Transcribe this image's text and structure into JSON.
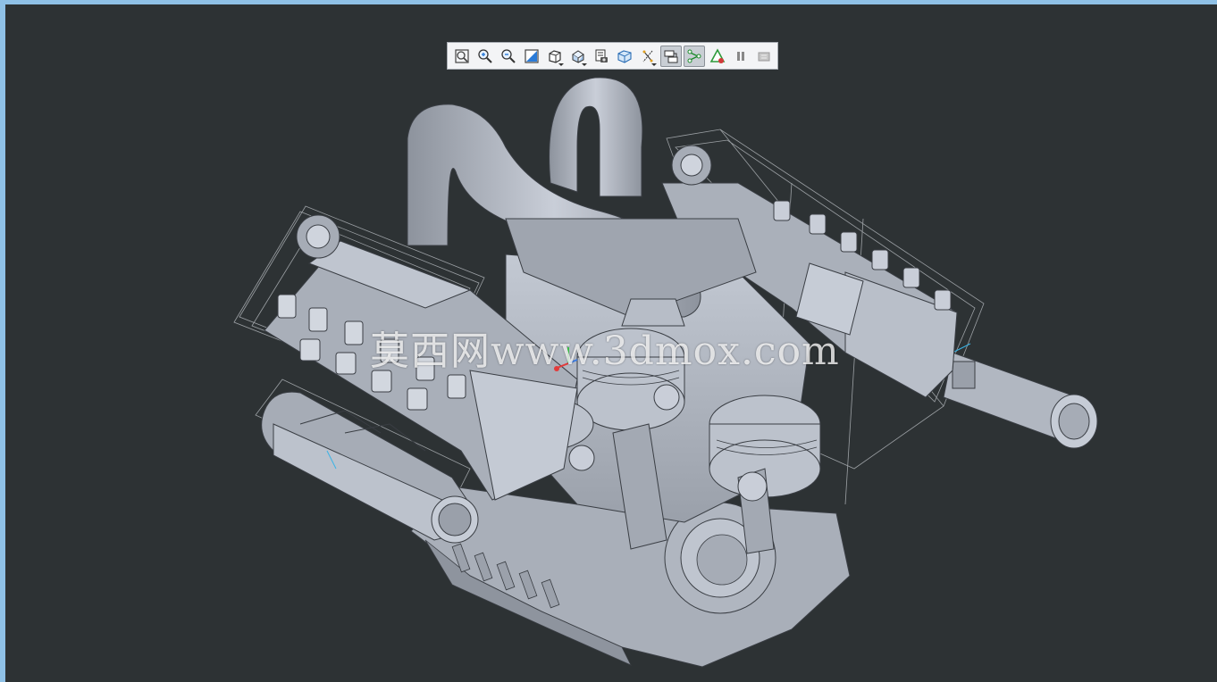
{
  "app": {
    "window_frame_color": "#8fc1e6",
    "background_color": "#2d3234"
  },
  "toolbar": {
    "buttons": [
      {
        "icon": "refit-icon",
        "active": false
      },
      {
        "icon": "zoom-in-icon",
        "active": false
      },
      {
        "icon": "zoom-out-icon",
        "active": false
      },
      {
        "icon": "repaint-icon",
        "active": false
      },
      {
        "icon": "display-style-icon",
        "active": false,
        "flyout": true
      },
      {
        "icon": "saved-orientations-icon",
        "active": false,
        "flyout": true
      },
      {
        "icon": "view-manager-icon",
        "active": false
      },
      {
        "icon": "perspective-view-icon",
        "active": false
      },
      {
        "icon": "datum-display-icon",
        "active": false,
        "flyout": true
      },
      {
        "icon": "spin-center-icon",
        "active": true
      },
      {
        "icon": "connection-display-icon",
        "active": true
      },
      {
        "icon": "annotation-display-icon",
        "active": false
      },
      {
        "icon": "pause-icon",
        "active": false
      },
      {
        "icon": "dynamic-view-icon",
        "active": false
      }
    ]
  },
  "model": {
    "part_color": "#b3b9c5",
    "edge_color": "#3a3e44",
    "hidden_line_color": "#d7dbe0"
  },
  "watermark": {
    "text": "莫西网www.3dmox.com"
  }
}
